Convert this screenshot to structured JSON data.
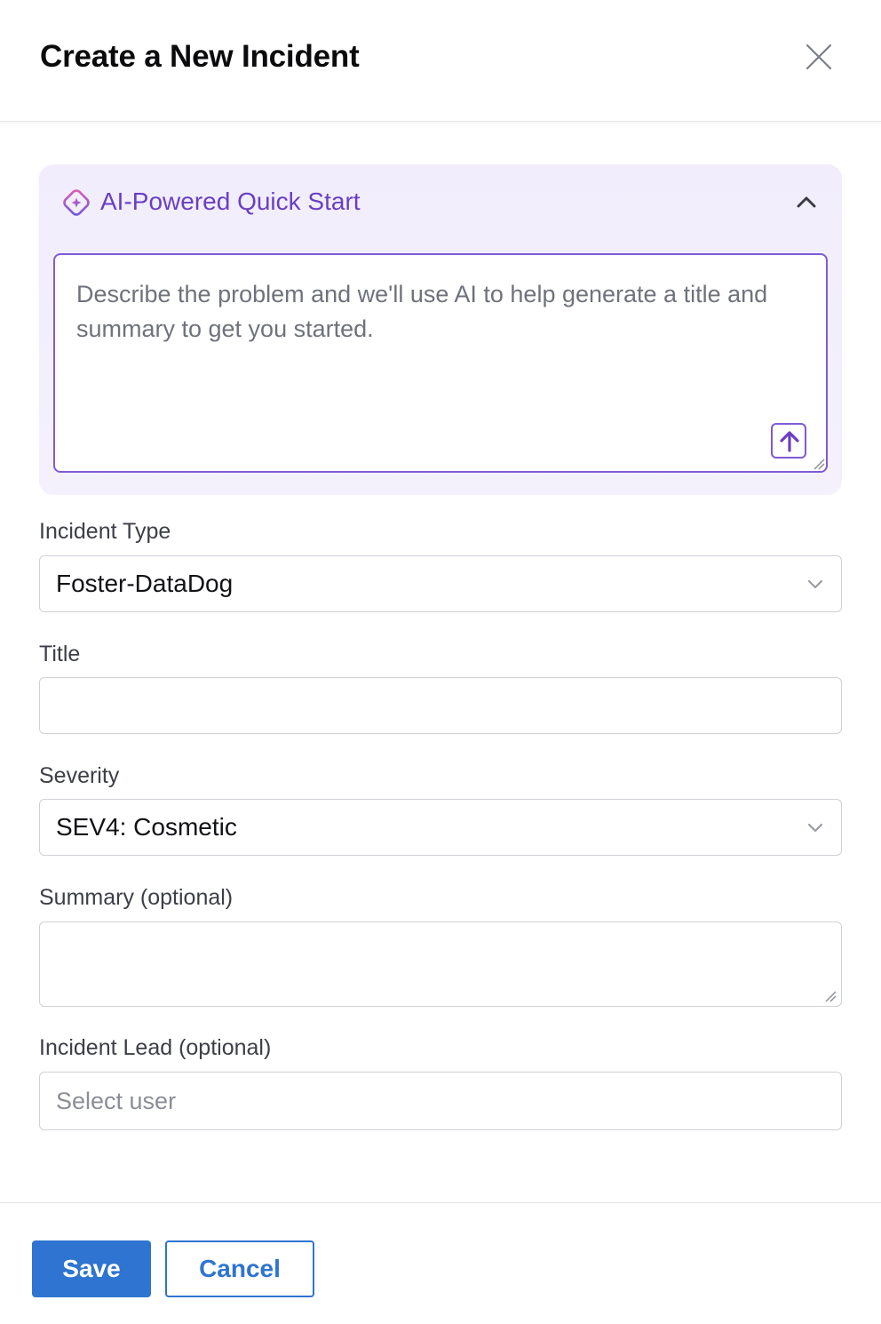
{
  "dialog": {
    "title": "Create a New Incident",
    "close_icon": "close-icon"
  },
  "ai_quick_start": {
    "title": "AI-Powered Quick Start",
    "icon": "ai-sparkle-icon",
    "collapse_icon": "chevron-up-icon",
    "prompt_placeholder": "Describe the problem and we'll use AI to help generate a title and summary to get you started.",
    "prompt_value": "",
    "submit_icon": "arrow-up-icon"
  },
  "fields": {
    "incident_type": {
      "label": "Incident Type",
      "value": "Foster-DataDog"
    },
    "title": {
      "label": "Title",
      "value": "",
      "placeholder": ""
    },
    "severity": {
      "label": "Severity",
      "value": "SEV4: Cosmetic"
    },
    "summary": {
      "label": "Summary (optional)",
      "value": ""
    },
    "incident_lead": {
      "label": "Incident Lead (optional)",
      "placeholder": "Select user",
      "value": ""
    }
  },
  "footer": {
    "save_label": "Save",
    "cancel_label": "Cancel"
  },
  "colors": {
    "accent": "#2f74d0",
    "ai_purple": "#6a3fc2",
    "ai_border": "#7f5ad6",
    "ai_panel_bg": "#f1edfc"
  }
}
